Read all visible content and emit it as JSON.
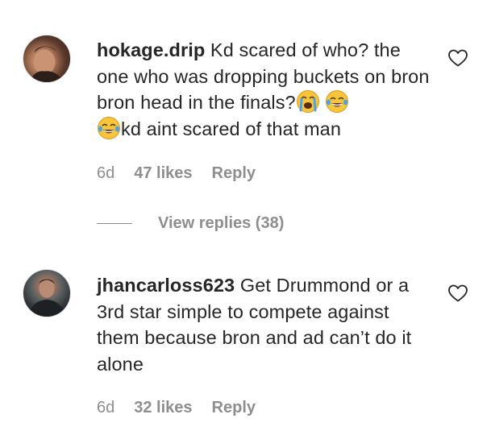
{
  "comments": [
    {
      "username": "hokage.drip",
      "text_1": " Kd scared of who? the one who was dropping buckets on bron bron head in the finals?",
      "text_2": "kd aint scared of that man",
      "emojis": [
        "loudly-crying-face",
        "face-with-tears-of-joy",
        "face-with-tears-of-joy"
      ],
      "age": "6d",
      "likes": "47 likes",
      "reply_label": "Reply",
      "view_replies": "View replies (38)"
    },
    {
      "username": "jhancarloss623",
      "text_1": " Get Drummond or a 3rd star simple to compete against them because bron and ad can’t do it alone",
      "age": "6d",
      "likes": "32 likes",
      "reply_label": "Reply"
    }
  ],
  "colors": {
    "text": "#262626",
    "muted": "#8e8e8e",
    "background": "#ffffff"
  },
  "icons": {
    "like": "heart-outline-icon"
  }
}
